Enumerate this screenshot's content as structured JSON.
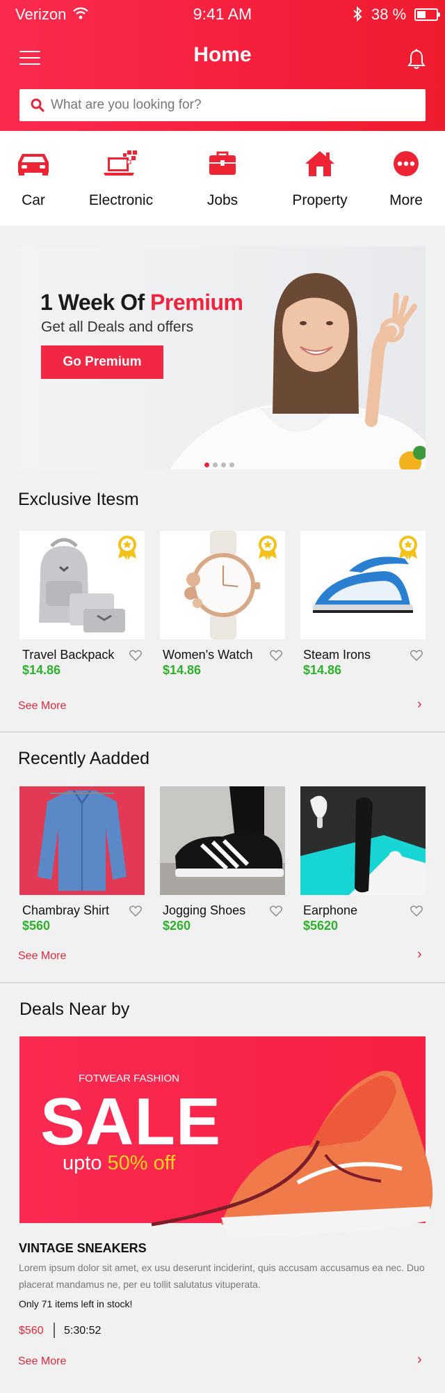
{
  "status_bar": {
    "carrier": "Verizon",
    "time": "9:41 AM",
    "battery": "38 %"
  },
  "header": {
    "title": "Home"
  },
  "search": {
    "placeholder": "What are you looking for?"
  },
  "categories": [
    {
      "label": "Car",
      "icon": "car-icon"
    },
    {
      "label": "Electronic",
      "icon": "laptop-icon"
    },
    {
      "label": "Jobs",
      "icon": "briefcase-icon"
    },
    {
      "label": "Property",
      "icon": "house-icon"
    },
    {
      "label": "More",
      "icon": "more-dots-icon"
    }
  ],
  "banner": {
    "title_plain": "1 Week Of ",
    "title_accent": "Premium",
    "subtitle": "Get all Deals and offers",
    "button": "Go Premium",
    "slides": 4,
    "active_slide": 1
  },
  "exclusive": {
    "title": "Exclusive Itesm",
    "items": [
      {
        "name": "Travel Backpack",
        "price": "$14.86"
      },
      {
        "name": "Women's Watch",
        "price": "$14.86"
      },
      {
        "name": "Steam Irons",
        "price": "$14.86"
      }
    ],
    "see_more": "See More"
  },
  "recent": {
    "title": "Recently Aadded",
    "items": [
      {
        "name": "Chambray Shirt",
        "price": "$560"
      },
      {
        "name": "Jogging Shoes",
        "price": "$260"
      },
      {
        "name": "Earphone",
        "price": "$5620"
      }
    ],
    "see_more": "See More"
  },
  "deals": {
    "title": "Deals Near by",
    "kicker": "FOTWEAR FASHION",
    "sale": "SALE",
    "upto": "upto ",
    "discount": "50% off",
    "name": "VINTAGE SNEAKERS",
    "description": "Lorem ipsum dolor sit amet, ex usu deserunt inciderint, quis accusam accusamus ea nec. Duo placerat mandamus ne, per eu tollit salutatus vituperata.",
    "stock": "Only 71 items left in stock!",
    "price": "$560",
    "timer": "5:30:52",
    "see_more": "See More"
  },
  "colors": {
    "brand": "#f61f3c",
    "price_green": "#2db12d",
    "link_red": "#e0283c"
  }
}
